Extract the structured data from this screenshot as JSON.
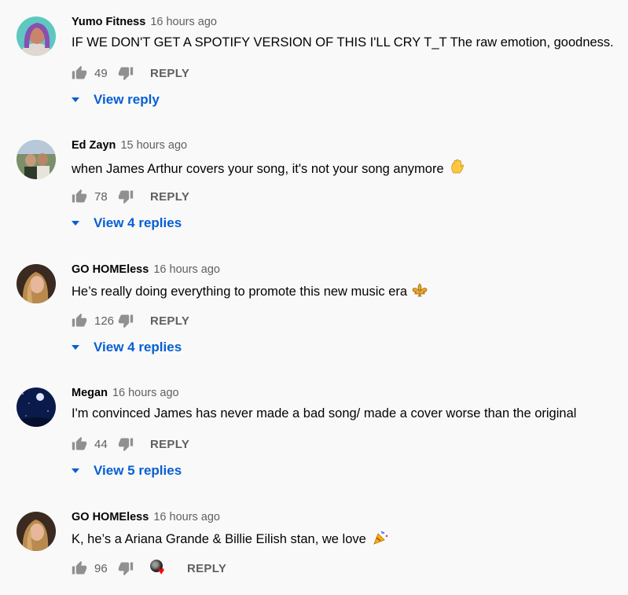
{
  "comments": [
    {
      "author": "Yumo Fitness",
      "time": "16 hours ago",
      "text": "IF WE DON'T GET A SPOTIFY VERSION OF THIS I'LL CRY T_T The raw emotion, goodness.",
      "likes": "49",
      "reply_label": "REPLY",
      "view_replies": "View reply"
    },
    {
      "author": "Ed Zayn",
      "time": "15 hours ago",
      "text": "when James Arthur covers your song, it's not your song anymore",
      "likes": "78",
      "reply_label": "REPLY",
      "view_replies": "View 4 replies"
    },
    {
      "author": "GO HOMEless",
      "time": "16 hours ago",
      "text": "He’s really doing everything to promote this new music era",
      "likes": "126",
      "reply_label": "REPLY",
      "view_replies": "View 4 replies"
    },
    {
      "author": "Megan",
      "time": "16 hours ago",
      "text": "I'm convinced James has never made a bad song/ made a cover worse than the original",
      "likes": "44",
      "reply_label": "REPLY",
      "view_replies": "View 5 replies"
    },
    {
      "author": "GO HOMEless",
      "time": "16 hours ago",
      "text": "K, he’s a Ariana Grande & Billie Eilish stan, we love",
      "likes": "96",
      "reply_label": "REPLY"
    }
  ],
  "colors": {
    "background": "#f9f9f9",
    "link_blue": "#065fd4",
    "secondary_text": "#606060",
    "icon_gray": "#909090",
    "heart_red": "#ff0000"
  }
}
